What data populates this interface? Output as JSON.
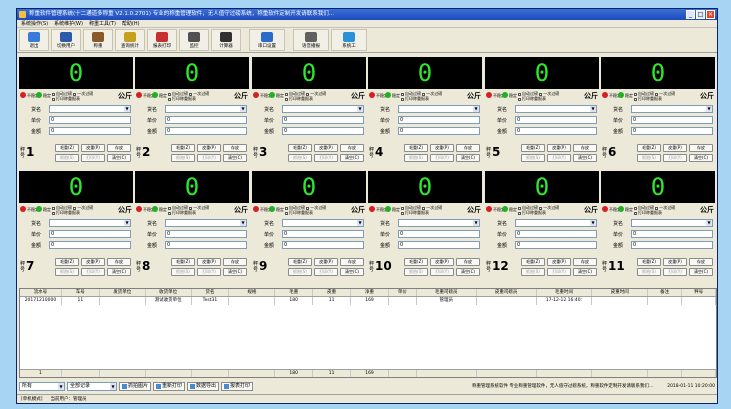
{
  "window": {
    "title": "称重软件管理系统(十二通道多称重 V2.1.0.2701) 专业的称重管理软件，无人值守过磅系统，称重软件定制开发请联系我们...",
    "minimize": "_",
    "maximize": "□",
    "close": "×"
  },
  "menu": [
    "系统操作(S)",
    "系统维护(W)",
    "称重工具(T)",
    "帮助(H)"
  ],
  "toolbar": [
    {
      "label": "退出",
      "icon": "exit-icon",
      "color": "#3a7ad8"
    },
    {
      "label": "切换用户",
      "icon": "switch-user-icon",
      "color": "#2a5aa8"
    },
    {
      "label": "称重",
      "icon": "scale-icon",
      "color": "#8a5a28"
    },
    {
      "label": "查询统计",
      "icon": "chart-icon",
      "color": "#c8a020"
    },
    {
      "label": "报表打印",
      "icon": "print-report-icon",
      "color": "#c83030"
    },
    {
      "label": "监控",
      "icon": "monitor-icon",
      "color": "#505050"
    },
    {
      "label": "计算器",
      "icon": "calculator-icon",
      "color": "#303030"
    },
    {
      "label": "串口设置",
      "icon": "port-settings-icon",
      "color": "#2a6ac8"
    },
    {
      "label": "语音播报",
      "icon": "voice-icon",
      "color": "#606060"
    },
    {
      "label": "系统工",
      "icon": "tools-icon",
      "color": "#2a90d8"
    }
  ],
  "scale_common": {
    "reading": "0",
    "status_unstable": "不稳定",
    "status_stable": "稳定",
    "check_auto": "自动过磅",
    "check_print": "打印称重报表",
    "check_once": "一次过磅",
    "unit": "公斤",
    "goods_label": "货名",
    "price_label": "单价",
    "amount_label": "金额",
    "price_value": "0",
    "amount_value": "0",
    "scale_label": "秤号",
    "btn_gross": "毛重(Z)",
    "btn_tare": "皮重(P)",
    "btn_save": "存皮",
    "btn_capture": "抓拍(S)",
    "btn_print": "打印(Y)",
    "btn_clear": "清空(C)"
  },
  "scale_numbers": [
    "1",
    "2",
    "3",
    "4",
    "5",
    "6",
    "7",
    "8",
    "9",
    "10",
    "12",
    "11"
  ],
  "table": {
    "headers": [
      "流水号",
      "车号",
      "发货单位",
      "收货单位",
      "货名",
      "规格",
      "毛重",
      "皮重",
      "净重",
      "单价",
      "毛重司磅员",
      "皮重司磅员",
      "毛重时间",
      "皮重时间",
      "备注",
      "秤号"
    ],
    "rows": [
      [
        "20171210000",
        "11",
        "",
        "测试收货单位",
        "Test31",
        "",
        "180",
        "11",
        "169",
        "",
        "管理员",
        "",
        "17-12-12 16:40:",
        "",
        "",
        ""
      ]
    ],
    "footer": [
      "1",
      "",
      "",
      "",
      "",
      "",
      "180",
      "11",
      "169",
      "",
      "",
      "",
      "",
      "",
      "",
      ""
    ]
  },
  "bottom": {
    "filter_day": "所有",
    "filter_record": "全部记录",
    "btn_capture_img": "抓拍图片",
    "btn_reprint": "重新打印",
    "btn_export": "数据导出",
    "btn_report": "报表打印",
    "ticker": "称重管理系统软件 专业称重管理软件，无人值守过磅系统，称重软件定制开发请联系我们...",
    "clock": "2018-01-11 10:20:00"
  },
  "status": {
    "mode": "[单机模式]",
    "user_label": "当前用户：管理员"
  }
}
